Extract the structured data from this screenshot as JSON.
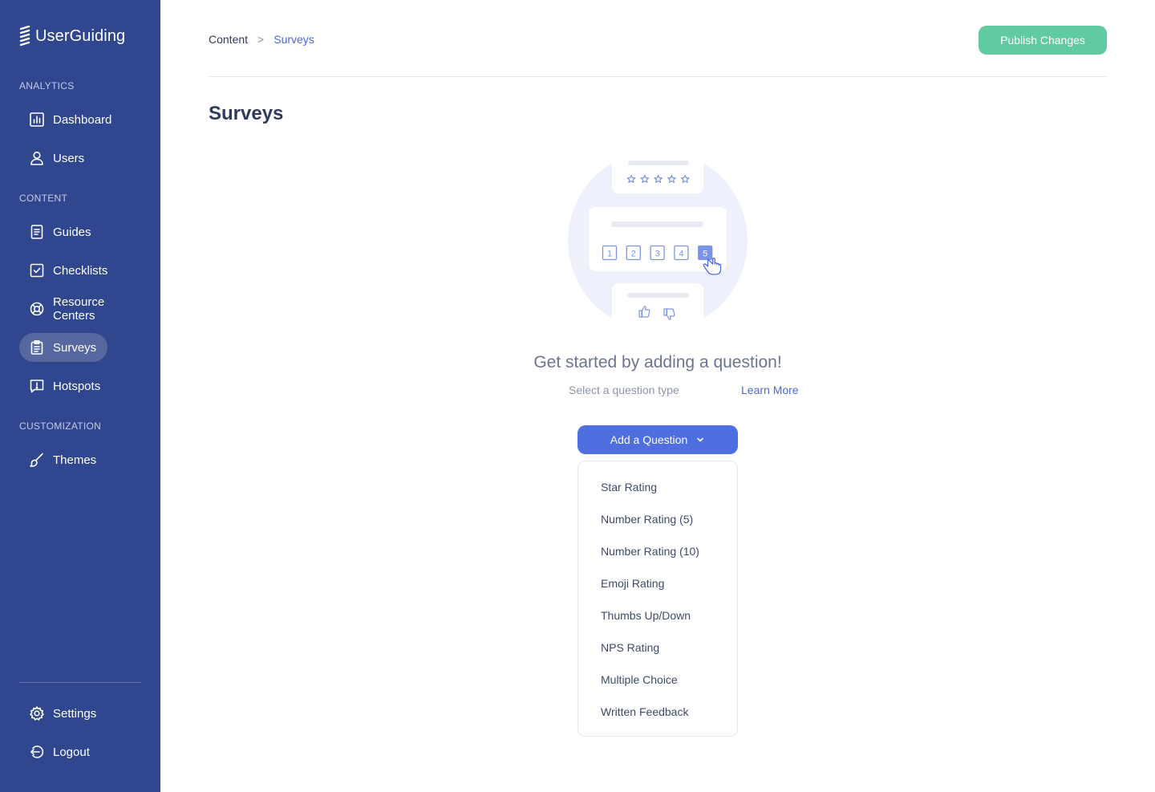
{
  "brand": {
    "name": "UserGuiding"
  },
  "sidebar": {
    "sections": {
      "analytics": "ANALYTICS",
      "content": "CONTENT",
      "customization": "CUSTOMIZATION"
    },
    "items": [
      {
        "label": "Dashboard",
        "icon": "bar-chart-icon"
      },
      {
        "label": "Users",
        "icon": "user-icon"
      },
      {
        "label": "Guides",
        "icon": "document-icon"
      },
      {
        "label": "Checklists",
        "icon": "checkbox-icon"
      },
      {
        "label": "Resource Centers",
        "icon": "lifebuoy-icon"
      },
      {
        "label": "Surveys",
        "icon": "clipboard-icon",
        "active": true
      },
      {
        "label": "Hotspots",
        "icon": "alert-message-icon"
      },
      {
        "label": "Themes",
        "icon": "brush-icon"
      }
    ],
    "bottom": [
      {
        "label": "Settings",
        "icon": "gear-icon"
      },
      {
        "label": "Logout",
        "icon": "logout-icon"
      }
    ]
  },
  "header": {
    "breadcrumb": {
      "root": "Content",
      "separator": ">",
      "current": "Surveys"
    },
    "publish_label": "Publish Changes"
  },
  "page": {
    "title": "Surveys",
    "empty_title": "Get started by adding a question!",
    "subtitle": "Select a question type",
    "learn_more": "Learn More",
    "add_label": "Add a Question"
  },
  "illustration": {
    "numbers": [
      "1",
      "2",
      "3",
      "4",
      "5"
    ],
    "selected": "5"
  },
  "dropdown": {
    "options": [
      "Star Rating",
      "Number Rating (5)",
      "Number Rating (10)",
      "Emoji Rating",
      "Thumbs Up/Down",
      "NPS Rating",
      "Multiple Choice",
      "Written Feedback"
    ]
  },
  "colors": {
    "sidebar_bg": "#30468e",
    "active_item_bg": "#56689f",
    "publish_green": "#60cba0",
    "primary_blue": "#4f6ee0",
    "link_blue": "#4a69d8",
    "illustration_circle": "#eef0fb"
  }
}
